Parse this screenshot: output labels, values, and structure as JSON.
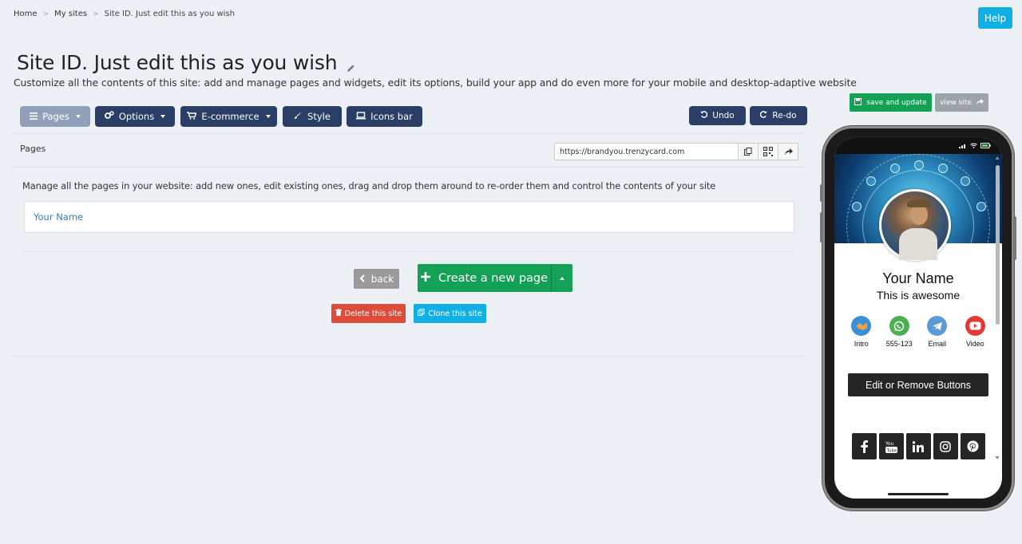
{
  "breadcrumb": {
    "home": "Home",
    "my_sites": "My sites",
    "current": "Site ID. Just edit this as you wish",
    "separator": ">"
  },
  "help_label": "Help",
  "page": {
    "title": "Site ID. Just edit this as you wish",
    "subtitle": "Customize all the contents of this site: add and manage pages and widgets, edit its options, build your app and do even more for your mobile and desktop-adaptive website"
  },
  "toolbar": {
    "pages": "Pages",
    "options": "Options",
    "ecommerce": "E-commerce",
    "style": "Style",
    "icons_bar": "Icons bar",
    "undo": "Undo",
    "redo": "Re-do"
  },
  "preview": {
    "save": "save and update",
    "view": "view site"
  },
  "section": {
    "label": "Pages",
    "url": "https://brandyou.trenzycard.com",
    "description": "Manage all the pages in your website: add new ones, edit existing ones, drag and drop them around to re-order them and control the contents of your site",
    "pages_list": [
      "Your Name"
    ]
  },
  "actions": {
    "back": "back",
    "create": "Create a new page",
    "delete": "Delete this site",
    "clone": "Clone this site"
  },
  "phone": {
    "name": "Your Name",
    "tagline": "This is awesome",
    "contact_icons": [
      {
        "label": "Intro",
        "icon": "intro-icon",
        "color": "#3b8fd6"
      },
      {
        "label": "555-123",
        "icon": "whatsapp-icon",
        "color": "#4caf50"
      },
      {
        "label": "Email",
        "icon": "telegram-icon",
        "color": "#5b9bd5"
      },
      {
        "label": "Video",
        "icon": "youtube-icon",
        "color": "#e53935"
      }
    ],
    "edit_button": "Edit or Remove Buttons",
    "social": [
      "facebook-icon",
      "youtube-icon",
      "linkedin-icon",
      "instagram-icon",
      "pinterest-icon"
    ]
  },
  "colors": {
    "primary": "#2b3e66",
    "success": "#13a155",
    "info": "#10b0e6",
    "danger": "#dd4b39"
  }
}
